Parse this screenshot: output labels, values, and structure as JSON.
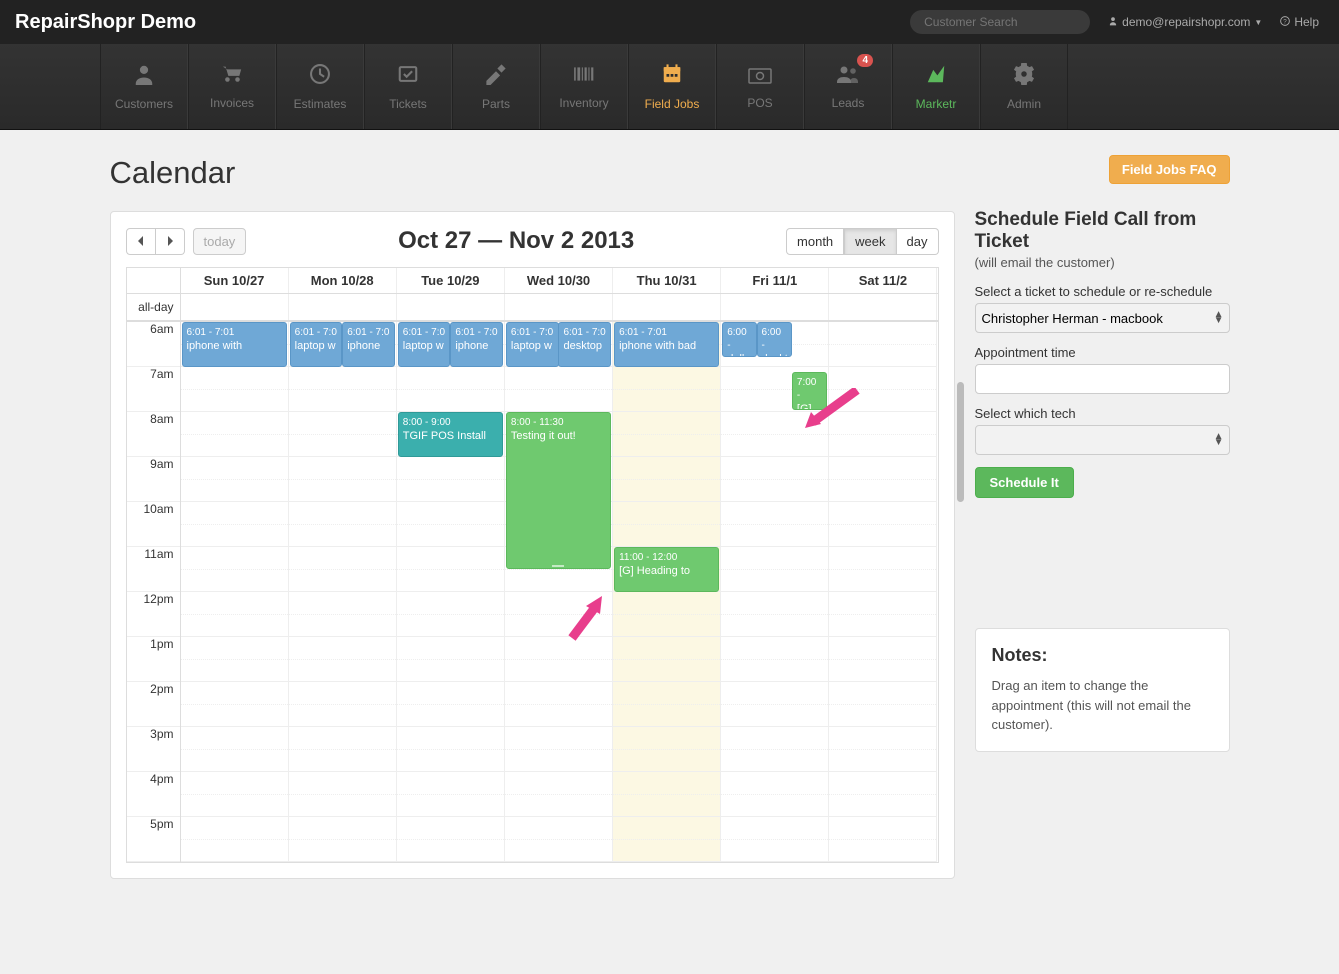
{
  "topbar": {
    "brand": "RepairShopr Demo",
    "search_placeholder": "Customer Search",
    "user_label": "demo@repairshopr.com",
    "help_label": "Help"
  },
  "nav": {
    "items": [
      {
        "label": "Customers"
      },
      {
        "label": "Invoices"
      },
      {
        "label": "Estimates"
      },
      {
        "label": "Tickets"
      },
      {
        "label": "Parts"
      },
      {
        "label": "Inventory"
      },
      {
        "label": "Field Jobs"
      },
      {
        "label": "POS"
      },
      {
        "label": "Leads",
        "badge": "4"
      },
      {
        "label": "Marketr"
      },
      {
        "label": "Admin"
      }
    ]
  },
  "page": {
    "title": "Calendar",
    "faq_btn": "Field Jobs FAQ"
  },
  "calendar": {
    "today_label": "today",
    "title": "Oct 27 — Nov 2 2013",
    "views": {
      "month": "month",
      "week": "week",
      "day": "day"
    },
    "allday_label": "all-day",
    "days": [
      "Sun 10/27",
      "Mon 10/28",
      "Tue 10/29",
      "Wed 10/30",
      "Thu 10/31",
      "Fri 11/1",
      "Sat 11/2"
    ],
    "hours": [
      "6am",
      "7am",
      "8am",
      "9am",
      "10am",
      "11am",
      "12pm",
      "1pm",
      "2pm",
      "3pm",
      "4pm",
      "5pm"
    ],
    "events": {
      "sun_a": {
        "time": "6:01 - 7:01",
        "title": "iphone with"
      },
      "mon_a": {
        "time": "6:01 - 7:0",
        "title": "laptop w"
      },
      "mon_b": {
        "time": "6:01 - 7:0",
        "title": "iphone"
      },
      "tue_a": {
        "time": "6:01 - 7:0",
        "title": "laptop w"
      },
      "tue_b": {
        "time": "6:01 - 7:0",
        "title": "iphone"
      },
      "tue_c": {
        "time": "8:00 - 9:00",
        "title": "TGIF POS Install"
      },
      "wed_a": {
        "time": "6:01 - 7:0",
        "title": "laptop w"
      },
      "wed_b": {
        "time": "6:01 - 7:0",
        "title": "desktop"
      },
      "wed_c": {
        "time": "8:00 - 11:30",
        "title": "Testing it out!"
      },
      "thu_a": {
        "time": "6:01 - 7:01",
        "title": "iphone with bad"
      },
      "thu_b": {
        "time": "11:00 - 12:00",
        "title": "[G] Heading to"
      },
      "fri_a": {
        "time": "6:00 -",
        "title": "dell"
      },
      "fri_b": {
        "time": "6:00 -",
        "title": "deskt"
      },
      "fri_c": {
        "time": "7:00 -",
        "title": "[G]"
      }
    }
  },
  "sidebar": {
    "heading": "Schedule Field Call from Ticket",
    "subheading": "(will email the customer)",
    "ticket_label": "Select a ticket to schedule or re-schedule",
    "ticket_value": "Christopher Herman - macbook",
    "appt_label": "Appointment time",
    "tech_label": "Select which tech",
    "schedule_btn": "Schedule It",
    "notes_heading": "Notes:",
    "notes_body": "Drag an item to change the appointment (this will not email the customer)."
  }
}
